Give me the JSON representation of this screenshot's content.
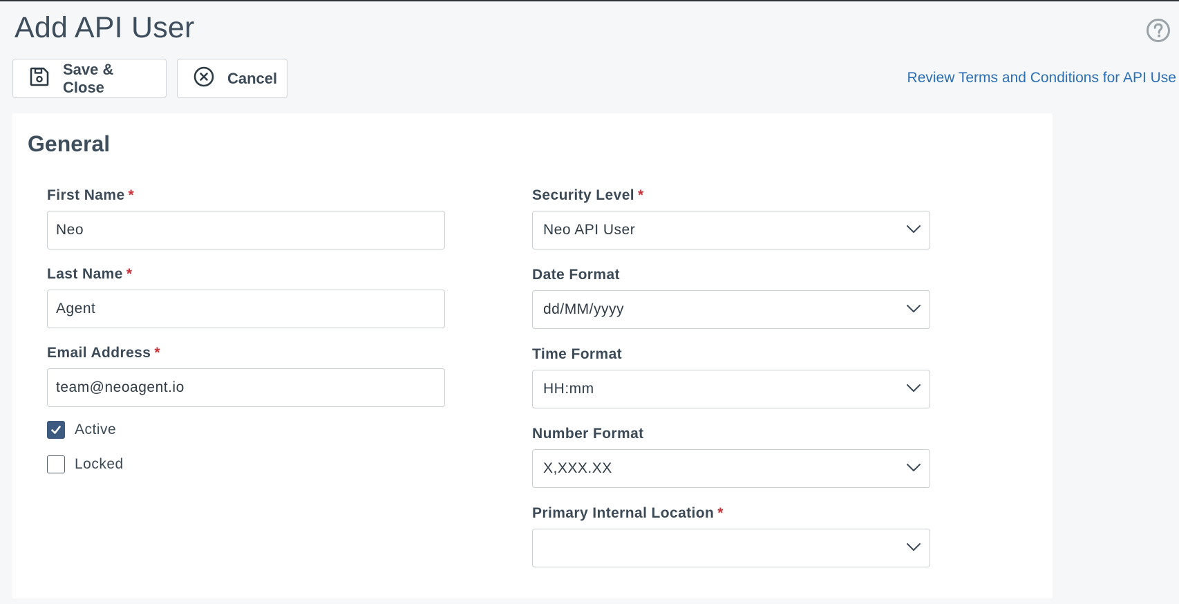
{
  "page": {
    "title": "Add API User"
  },
  "toolbar": {
    "save_label": "Save & Close",
    "cancel_label": "Cancel",
    "terms_link": "Review Terms and Conditions for API Use"
  },
  "general": {
    "title": "General",
    "required_marker": "*",
    "first_name": {
      "label": "First Name",
      "value": "Neo"
    },
    "last_name": {
      "label": "Last Name",
      "value": "Agent"
    },
    "email": {
      "label": "Email Address",
      "value": "team@neoagent.io"
    },
    "active": {
      "label": "Active",
      "checked": true
    },
    "locked": {
      "label": "Locked",
      "checked": false
    },
    "security_level": {
      "label": "Security Level",
      "value": "Neo API User"
    },
    "date_format": {
      "label": "Date Format",
      "value": "dd/MM/yyyy"
    },
    "time_format": {
      "label": "Time Format",
      "value": "HH:mm"
    },
    "number_format": {
      "label": "Number Format",
      "value": "X,XXX.XX"
    },
    "primary_location": {
      "label": "Primary Internal Location",
      "value": ""
    }
  },
  "colors": {
    "accent_link": "#2b6fb6",
    "required": "#c8343a",
    "checkbox_checked": "#3d5a80"
  }
}
